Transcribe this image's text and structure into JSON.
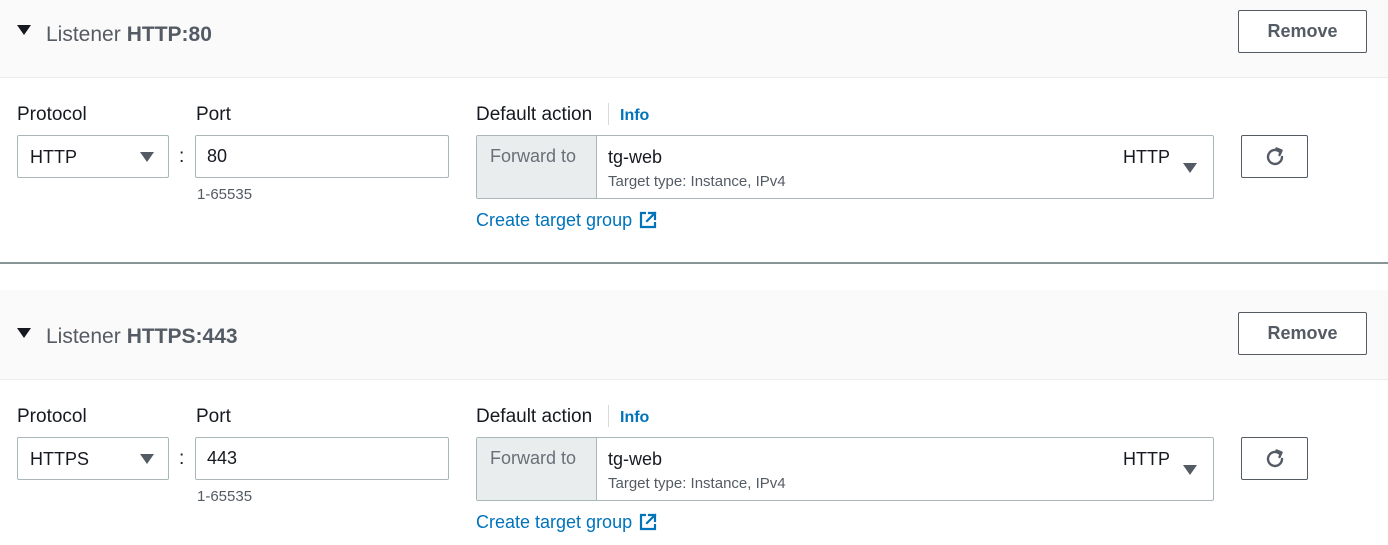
{
  "listeners": [
    {
      "header_label": "Listener",
      "header_value": "HTTP:80",
      "remove_label": "Remove",
      "protocol_label": "Protocol",
      "protocol_value": "HTTP",
      "port_label": "Port",
      "port_value": "80",
      "port_hint": "1-65535",
      "default_action_label": "Default action",
      "info_label": "Info",
      "forward_prefix": "Forward to",
      "target_group_name": "tg-web",
      "target_group_sub": "Target type: Instance, IPv4",
      "target_group_protocol": "HTTP",
      "create_target_group_label": "Create target group"
    },
    {
      "header_label": "Listener",
      "header_value": "HTTPS:443",
      "remove_label": "Remove",
      "protocol_label": "Protocol",
      "protocol_value": "HTTPS",
      "port_label": "Port",
      "port_value": "443",
      "port_hint": "1-65535",
      "default_action_label": "Default action",
      "info_label": "Info",
      "forward_prefix": "Forward to",
      "target_group_name": "tg-web",
      "target_group_sub": "Target type: Instance, IPv4",
      "target_group_protocol": "HTTP",
      "create_target_group_label": "Create target group"
    }
  ],
  "icons": {
    "collapse": "caret-down-icon",
    "dropdown": "chevron-down-icon",
    "refresh": "refresh-icon",
    "external": "external-link-icon"
  },
  "colors": {
    "link": "#0073bb",
    "header_bg": "#fafafa",
    "prefix_bg": "#eaeded"
  }
}
